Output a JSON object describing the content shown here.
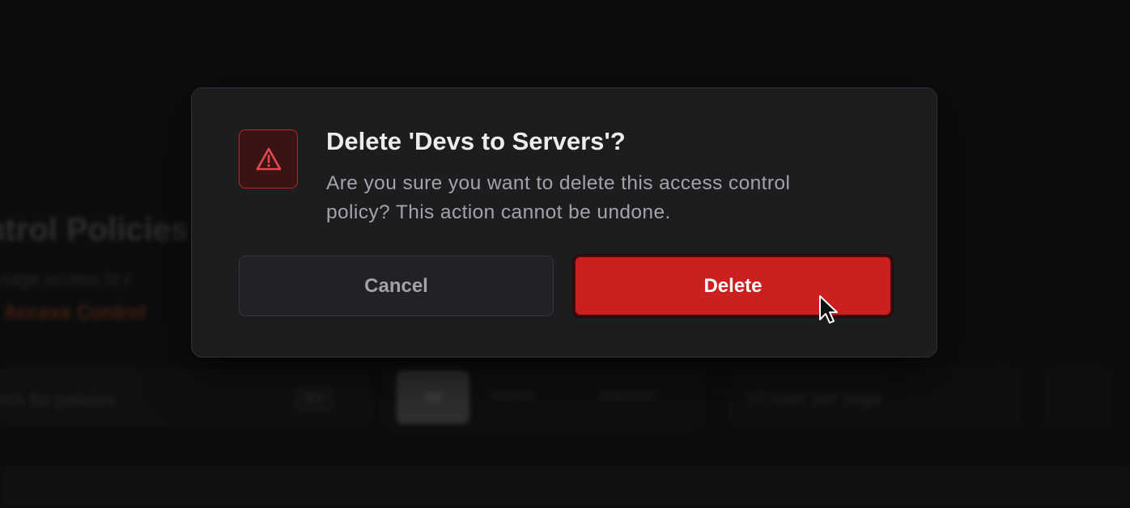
{
  "background": {
    "page_title": "ntrol Policies",
    "page_subtitle": "nage access to r",
    "page_link": "Access Control",
    "search_placeholder": "rch for policies",
    "search_shortcut": "⌘K",
    "segments": [
      "All",
      "Active",
      "Inactive"
    ],
    "rows_per_page": "10 rows per page"
  },
  "dialog": {
    "icon": "warning-triangle-icon",
    "title": "Delete 'Devs to Servers'?",
    "message": "Are you sure you want to delete this access control policy? This action cannot be undone.",
    "cancel_label": "Cancel",
    "delete_label": "Delete"
  },
  "colors": {
    "danger": "#cc1f20",
    "dialog_bg": "#1b1d1f",
    "warning_icon": "#e5484d"
  }
}
